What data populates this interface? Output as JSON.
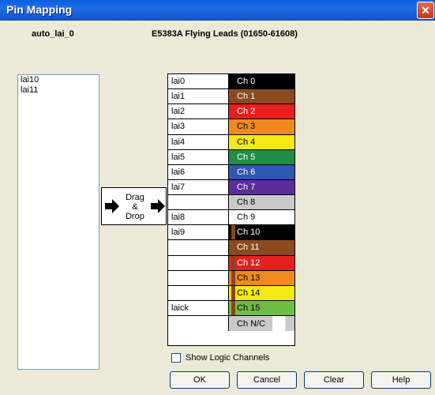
{
  "window": {
    "title": "Pin Mapping",
    "close_glyph": "✕"
  },
  "header": {
    "left": "auto_lai_0",
    "right": "E5383A Flying Leads (01650-61608)"
  },
  "unmapped": [
    "lai10",
    "lai11"
  ],
  "drag_drop": {
    "line1": "Drag",
    "line2": "&",
    "line3": "Drop"
  },
  "mapping": [
    {
      "pin": "lai0",
      "ch": "Ch 0",
      "bg": "#000000",
      "fg": "#ffffff"
    },
    {
      "pin": "lai1",
      "ch": "Ch 1",
      "bg": "#8b4a1f",
      "fg": "#ffffff"
    },
    {
      "pin": "lai2",
      "ch": "Ch 2",
      "bg": "#e62020",
      "fg": "#ffffff"
    },
    {
      "pin": "lai3",
      "ch": "Ch 3",
      "bg": "#f08a1e",
      "fg": "#000000"
    },
    {
      "pin": "lai4",
      "ch": "Ch 4",
      "bg": "#f2ea12",
      "fg": "#000000"
    },
    {
      "pin": "lai5",
      "ch": "Ch 5",
      "bg": "#1f8f45",
      "fg": "#ffffff"
    },
    {
      "pin": "lai6",
      "ch": "Ch 6",
      "bg": "#2f56b0",
      "fg": "#ffffff"
    },
    {
      "pin": "lai7",
      "ch": "Ch 7",
      "bg": "#5b2d96",
      "fg": "#ffffff"
    },
    {
      "pin": "",
      "ch": "Ch 8",
      "bg": "#c9c9c9",
      "fg": "#000000"
    },
    {
      "pin": "lai8",
      "ch": "Ch 9",
      "bg": "#ffffff",
      "fg": "#000000"
    },
    {
      "pin": "lai9",
      "ch": "Ch 10",
      "bg": "#000000",
      "fg": "#ffffff",
      "stub": true
    },
    {
      "pin": "",
      "ch": "Ch 11",
      "bg": "#8b4a1f",
      "fg": "#ffffff"
    },
    {
      "pin": "",
      "ch": "Ch 12",
      "bg": "#e62020",
      "fg": "#ffffff",
      "stub": true
    },
    {
      "pin": "",
      "ch": "Ch 13",
      "bg": "#f08a1e",
      "fg": "#000000",
      "stub": true
    },
    {
      "pin": "",
      "ch": "Ch 14",
      "bg": "#f2ea12",
      "fg": "#000000",
      "stub": true
    },
    {
      "pin": "laick",
      "ch": "Ch 15",
      "bg": "#6fbe44",
      "fg": "#000000",
      "stub": true
    },
    {
      "pin": "",
      "ch": "Ch N/C",
      "bg": "#c9c9c9",
      "fg": "#000000",
      "nc": true
    }
  ],
  "checkbox_label": "Show Logic Channels",
  "buttons": {
    "ok": "OK",
    "cancel": "Cancel",
    "clear": "Clear",
    "help": "Help"
  }
}
